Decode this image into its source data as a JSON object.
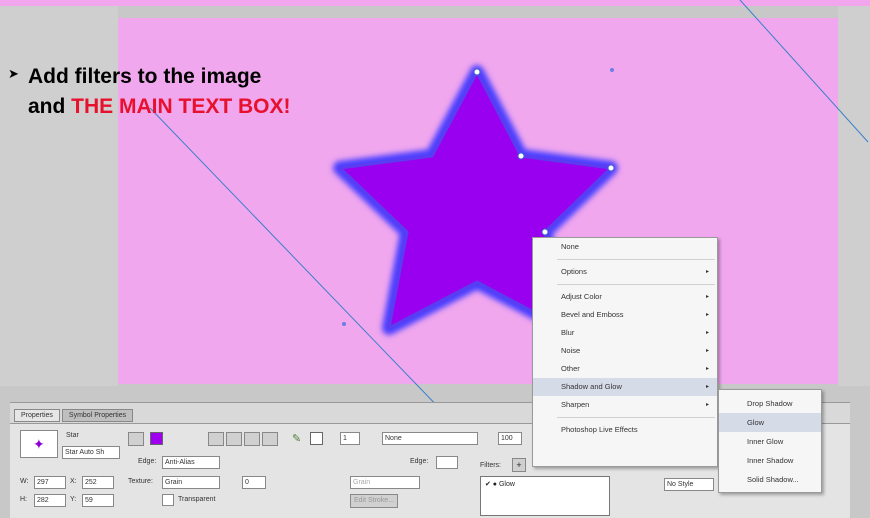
{
  "annotation": {
    "line1": "Add filters to the image",
    "line2_prefix": "and ",
    "line2_highlight": "THE MAIN TEXT BOX!"
  },
  "panel": {
    "tabs": [
      "Properties",
      "Symbol Properties"
    ],
    "object_type": "Star",
    "object_name": "Star Auto Sh",
    "w_label": "W:",
    "w_value": "297",
    "x_label": "X:",
    "x_value": "252",
    "h_label": "H:",
    "h_value": "282",
    "y_label": "Y:",
    "y_value": "59",
    "edge_label": "Edge:",
    "edge_value": "Anti-Alias",
    "texture_label": "Texture:",
    "texture_value": "Grain",
    "texture_amount": "0",
    "transparent_label": "Transparent",
    "stroke_size": "1",
    "stroke_type": "None",
    "stroke_edge_label": "Edge:",
    "stroke_texture": "Grain",
    "edit_stroke_label": "Edit Stroke...",
    "opacity_value": "100",
    "filters_label": "Filters:",
    "filters_items": [
      "Glow"
    ],
    "style_value": "No Style"
  },
  "menu": {
    "items": [
      {
        "label": "None",
        "arrow": false
      },
      {
        "label": "Options",
        "arrow": true
      },
      {
        "label": "Adjust Color",
        "arrow": true
      },
      {
        "label": "Bevel and Emboss",
        "arrow": true
      },
      {
        "label": "Blur",
        "arrow": true
      },
      {
        "label": "Noise",
        "arrow": true
      },
      {
        "label": "Other",
        "arrow": true
      },
      {
        "label": "Shadow and Glow",
        "arrow": true
      },
      {
        "label": "Sharpen",
        "arrow": true
      },
      {
        "label": "Photoshop Live Effects",
        "arrow": false
      }
    ],
    "chevron": "▸"
  },
  "submenu": {
    "items": [
      "Drop Shadow",
      "Glow",
      "Inner Glow",
      "Inner Shadow",
      "Solid Shadow..."
    ]
  },
  "colors": {
    "background": "#f2a6ee",
    "star_fill": "#9a00f0",
    "star_glow": "#4a3cff",
    "annotation_red": "#e8112d",
    "line": "#3a7fc9"
  }
}
